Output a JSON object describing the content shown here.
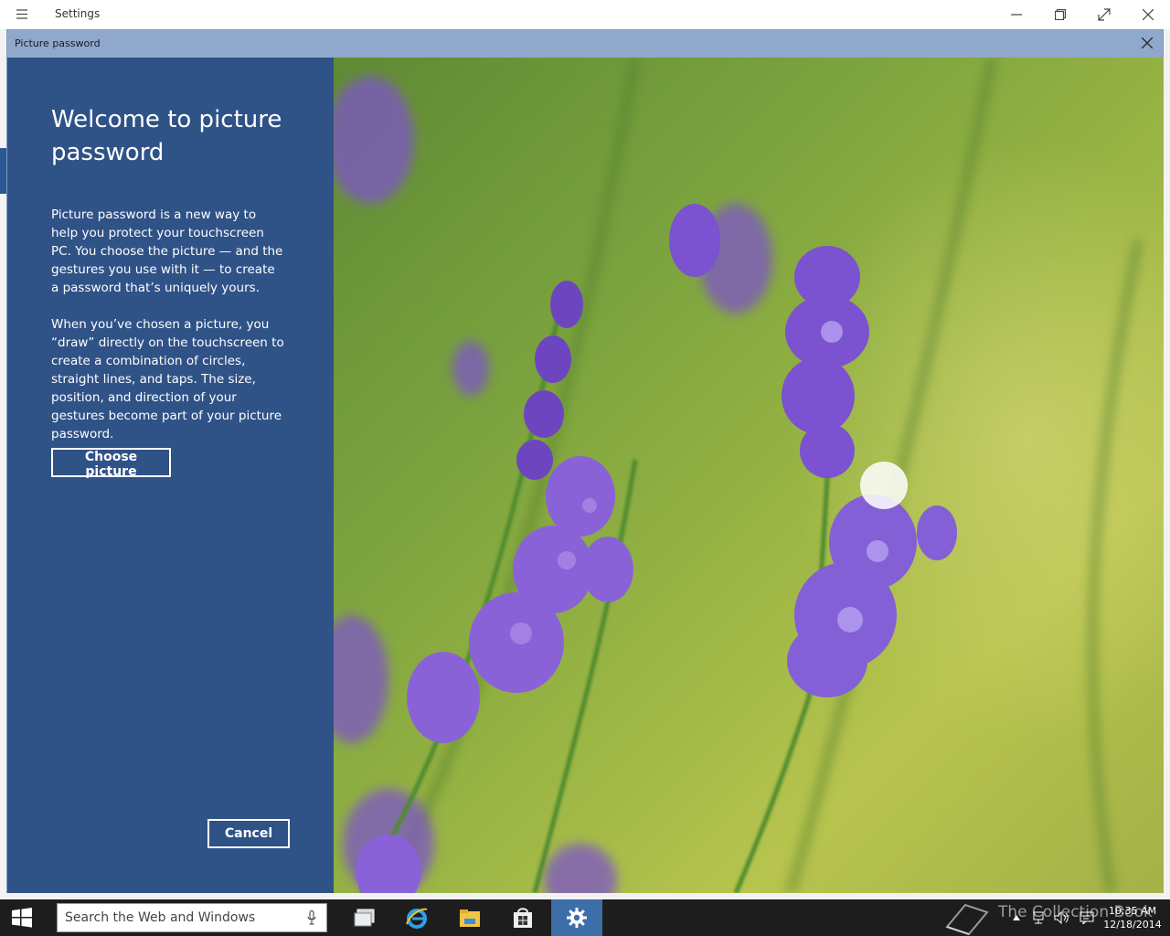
{
  "app": {
    "title": "Settings",
    "menu_icon": "hamburger-icon",
    "window_controls": [
      "minimize-icon",
      "restore-icon",
      "fullscreen-icon",
      "close-icon"
    ]
  },
  "dialog": {
    "title": "Picture password",
    "close_icon": "close-icon",
    "heading": "Welcome to picture password",
    "paragraph1": "Picture password is a new way to help you protect your touchscreen PC. You choose the picture — and the gestures you use with it — to create a password that’s uniquely yours.",
    "paragraph2": "When you’ve chosen a picture, you “draw” directly on the touchscreen to create a combination of circles, straight lines, and taps. The size, position, and direction of your gestures become part of your picture password.",
    "choose_button": "Choose picture",
    "cancel_button": "Cancel",
    "accent_color": "#2f5287",
    "titlebar_color": "#8fa8cc"
  },
  "taskbar": {
    "search_placeholder": "Search the Web and Windows",
    "icons": [
      "windows-start-icon",
      "microphone-icon",
      "task-view-icon",
      "internet-explorer-icon",
      "file-explorer-icon",
      "store-icon",
      "settings-gear-icon"
    ],
    "tray_icons": [
      "show-hidden-icons-icon",
      "network-icon",
      "volume-icon",
      "action-center-icon"
    ],
    "time": "10:35 AM",
    "date": "12/18/2014",
    "watermark": "The Collection Book"
  }
}
